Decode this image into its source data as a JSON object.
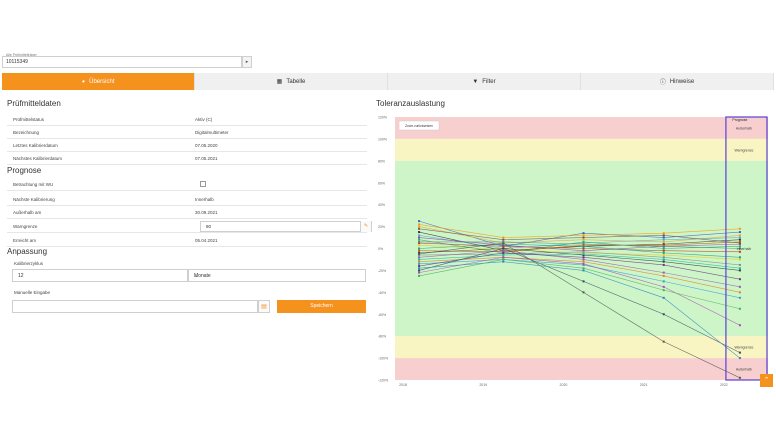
{
  "record": {
    "label": "Alle Prüfmittelträger",
    "value": "10115349"
  },
  "tabs": [
    {
      "label": "Übersicht",
      "icon": "dashboard-icon",
      "active": true
    },
    {
      "label": "Tabelle",
      "icon": "table-icon",
      "active": false
    },
    {
      "label": "Filter",
      "icon": "filter-icon",
      "active": false
    },
    {
      "label": "Hinweise",
      "icon": "info-icon",
      "active": false
    }
  ],
  "pruefmittel": {
    "title": "Prüfmitteldaten",
    "rows": [
      {
        "k": "Prüfmittelstatus",
        "v": "Aktiv (C)"
      },
      {
        "k": "Bezeichnung",
        "v": "Digitalmultimeter"
      },
      {
        "k": "Letztes Kalibrierdatum",
        "v": "07.05.2020"
      },
      {
        "k": "Nächstes Kalibrierdatum",
        "v": "07.05.2021"
      }
    ]
  },
  "prognose": {
    "title": "Prognose",
    "betrachtung": "Betrachtung mit WU",
    "naechste_k": "Nächste Kalibrierung",
    "naechste_v": "Innerhalb",
    "ausserhalb_k": "Außerhalb am",
    "ausserhalb_v": "30.09.2021",
    "warngrenze_k": "Warngrenze",
    "warngrenze_v": "80",
    "erreicht_k": "Erreicht am",
    "erreicht_v": "05.04.2021"
  },
  "anpassung": {
    "title": "Anpassung",
    "zyklus_label": "Kalibrierzyklus",
    "zyklus_value": "12",
    "einheit": "Monate",
    "manuell_label": "Manuelle Eingabe",
    "save_label": "Speichern"
  },
  "chart_data": {
    "type": "line",
    "title": "Toleranzauslastung",
    "reset_zoom": "Zoom zurücksetzen",
    "yticks": [
      "120%",
      "100%",
      "80%",
      "60%",
      "40%",
      "20%",
      "0%",
      "-20%",
      "-40%",
      "-60%",
      "-80%",
      "-100%",
      "-120%"
    ],
    "xticks": [
      "2018",
      "2019",
      "2020",
      "2021",
      "2022"
    ],
    "ylim": [
      -120,
      120
    ],
    "x": [
      2018.2,
      2019.25,
      2020.25,
      2021.25,
      2022.2
    ],
    "bands": [
      {
        "from": 100,
        "to": 120,
        "color": "#f7cfcf"
      },
      {
        "from": 80,
        "to": 100,
        "color": "#f8f5c2"
      },
      {
        "from": -80,
        "to": 80,
        "color": "#cdf5c8"
      },
      {
        "from": -100,
        "to": -80,
        "color": "#f8f5c2"
      },
      {
        "from": -120,
        "to": -100,
        "color": "#f7cfcf"
      }
    ],
    "prognose_label": "Prognose",
    "zone_labels": [
      {
        "text": "Außerhalb",
        "y": 110
      },
      {
        "text": "Warngrenze",
        "y": 90
      },
      {
        "text": "Innerhalb",
        "y": 0
      },
      {
        "text": "Warngrenze",
        "y": -90
      },
      {
        "text": "Außerhalb",
        "y": -110
      }
    ],
    "series": [
      {
        "color": "#3a5fcd",
        "values": [
          25,
          2,
          14,
          10,
          15
        ]
      },
      {
        "color": "#e9a23b",
        "values": [
          20,
          5,
          8,
          6,
          12
        ]
      },
      {
        "color": "#333333",
        "values": [
          15,
          -2,
          2,
          4,
          8
        ]
      },
      {
        "color": "#5aa0d8",
        "values": [
          12,
          0,
          5,
          8,
          10
        ]
      },
      {
        "color": "#8e44ad",
        "values": [
          10,
          3,
          -2,
          2,
          4
        ]
      },
      {
        "color": "#27ae60",
        "values": [
          8,
          -4,
          6,
          0,
          2
        ]
      },
      {
        "color": "#c0392b",
        "values": [
          5,
          2,
          0,
          -2,
          -3
        ]
      },
      {
        "color": "#f1c40f",
        "values": [
          3,
          -1,
          -4,
          -6,
          -10
        ]
      },
      {
        "color": "#16a085",
        "values": [
          0,
          4,
          2,
          -4,
          -8
        ]
      },
      {
        "color": "#d35400",
        "values": [
          -2,
          -3,
          3,
          3,
          6
        ]
      },
      {
        "color": "#2c3e50",
        "values": [
          -4,
          0,
          -6,
          -12,
          -20
        ]
      },
      {
        "color": "#7f8c8d",
        "values": [
          -6,
          -5,
          -3,
          -8,
          -15
        ]
      },
      {
        "color": "#9b59b6",
        "values": [
          -8,
          -2,
          -10,
          -22,
          -35
        ]
      },
      {
        "color": "#1abc9c",
        "values": [
          -10,
          -6,
          -5,
          -10,
          -18
        ]
      },
      {
        "color": "#e67e22",
        "values": [
          -12,
          -8,
          -12,
          -25,
          -40
        ]
      },
      {
        "color": "#3498db",
        "values": [
          -14,
          -10,
          -15,
          -30,
          -45
        ]
      },
      {
        "color": "#6c3483",
        "values": [
          -16,
          -4,
          -8,
          -15,
          -28
        ]
      },
      {
        "color": "#34495e",
        "values": [
          -20,
          0,
          -30,
          -60,
          -95
        ]
      },
      {
        "color": "#555555",
        "values": [
          -5,
          5,
          -40,
          -85,
          -118
        ]
      },
      {
        "color": "#2e86c1",
        "values": [
          -18,
          -12,
          -20,
          -45,
          -100
        ]
      },
      {
        "color": "#ab47bc",
        "values": [
          -22,
          -8,
          -14,
          -35,
          -70
        ]
      },
      {
        "color": "#4caf50",
        "values": [
          -25,
          -10,
          -18,
          -38,
          -55
        ]
      },
      {
        "color": "#ff9800",
        "values": [
          22,
          10,
          12,
          14,
          18
        ]
      },
      {
        "color": "#795548",
        "values": [
          18,
          8,
          10,
          12,
          5
        ]
      },
      {
        "color": "#607d8b",
        "values": [
          6,
          6,
          4,
          2,
          0
        ]
      }
    ]
  }
}
